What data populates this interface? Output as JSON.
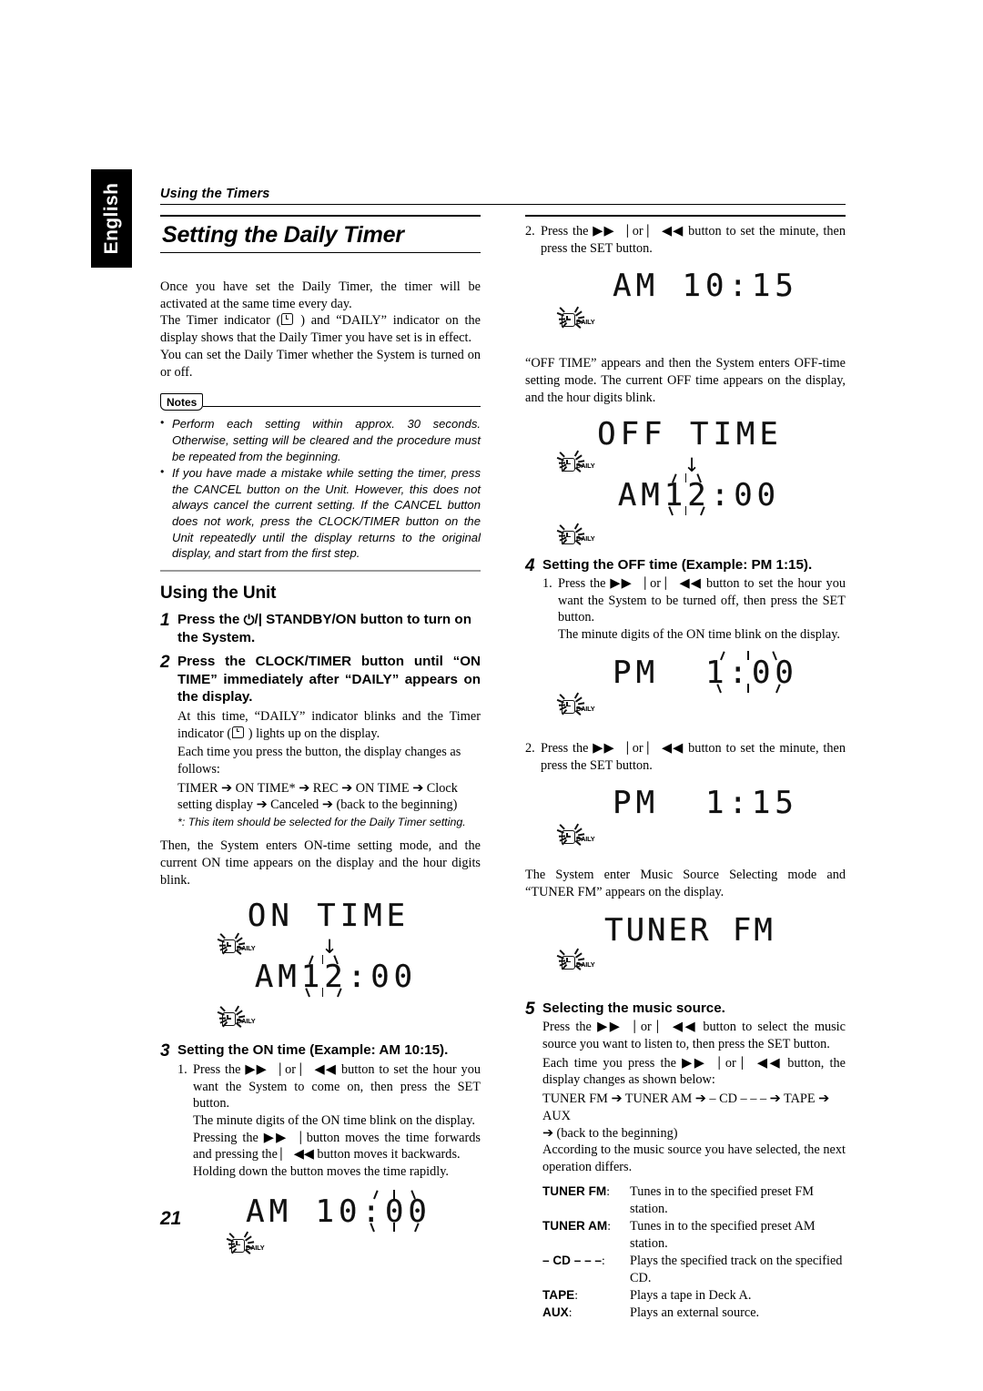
{
  "language_tab": "English",
  "running_head": "Using the Timers",
  "chapter_title": "Setting the Daily Timer",
  "page_number": "21",
  "intro": {
    "p1": "Once you have set the Daily Timer, the timer will be activated at the same time every day.",
    "p2_before": "The Timer indicator  (",
    "p2_after": " ) and “DAILY” indicator on the display shows that the Daily Timer you have set is in effect.",
    "p3": "You can set the Daily Timer whether the System is turned on or off."
  },
  "notes": {
    "label": "Notes",
    "items": [
      "Perform each setting within approx. 30 seconds. Otherwise, setting will be cleared and the procedure must be repeated from the beginning.",
      "If you have made a mistake while setting the timer, press the CANCEL button on the Unit. However, this does not always cancel the current setting. If the CANCEL button does not work, press the CLOCK/TIMER button on the Unit repeatedly until the display returns to the original display, and start from the first step."
    ]
  },
  "using_the_unit": {
    "heading": "Using the Unit",
    "step1": {
      "num": "1",
      "title_before": "Press the ",
      "power_icon": "⏻",
      "title_after": "/| STANDBY/ON button to turn on the System."
    },
    "step2": {
      "num": "2",
      "title": "Press the CLOCK/TIMER button until “ON TIME” immediately after “DAILY” appears on the display.",
      "sub1_before": "At this time, “DAILY” indicator blinks and the Timer indicator  (",
      "sub1_after": " ) lights up on the display.",
      "sub2": "Each time you press the button, the display changes as follows:",
      "sequence": "TIMER ➔ ON TIME* ➔ REC ➔ ON TIME ➔ Clock setting display ➔ Canceled ➔ (back to the beginning)",
      "footnote": "*: This item should be selected for the Daily Timer setting."
    },
    "after_step2": "Then, the System enters ON-time setting mode, and the current ON time appears on the display and the hour digits blink."
  },
  "figures": {
    "on_time": {
      "line1": "ON TIME",
      "arrow": "↓",
      "line2_static_left": "AM",
      "line2_blink": "12",
      "line2_static_right": ":00",
      "indicator": "DAILY"
    },
    "am_10_00": {
      "line_static_left": "AM 10",
      "line_blink": ":00",
      "indicator": "DAILY"
    },
    "am_10_15": {
      "line": "AM 10:15",
      "indicator": "DAILY"
    },
    "off_time": {
      "line1": "OFF TIME",
      "arrow": "↓",
      "line2_static_left": "AM",
      "line2_blink": "12",
      "line2_static_right": ":00",
      "indicator": "DAILY"
    },
    "pm_1_00": {
      "line_static_left": "PM  ",
      "line_blink": "1:00",
      "indicator": "DAILY"
    },
    "pm_1_15": {
      "line": "PM  1:15",
      "indicator": "DAILY"
    },
    "tuner_fm": {
      "line": "TUNER FM",
      "indicator": "DAILY"
    }
  },
  "step3": {
    "num": "3",
    "title": "Setting the ON time (Example: AM 10:15).",
    "item_num": "1.",
    "line1": "Press the ▶▶⎹ or ⎸◀◀ button to set the hour you want the System to come on, then press the SET button.",
    "line2": "The minute digits of the ON time blink on the display.",
    "line3": "Pressing the ▶▶⎹ button moves the time forwards and pressing the ⎸◀◀ button moves it backwards.",
    "line4": "Holding down the button moves the time rapidly."
  },
  "right_column": {
    "step3_item2": {
      "item_num": "2.",
      "text": "Press the ▶▶⎹ or ⎸◀◀ button to set the minute, then press the SET button."
    },
    "off_time_intro": "“OFF TIME” appears and then the System enters OFF-time setting mode. The current OFF time appears on the display, and the hour digits blink.",
    "step4": {
      "num": "4",
      "title": "Setting the OFF time (Example: PM 1:15).",
      "item1_num": "1.",
      "item1_line1": "Press the ▶▶⎹ or ⎸◀◀ button to set the hour you want the System to be turned off, then press the SET button.",
      "item1_line2": "The minute digits of the ON time blink on the display.",
      "item2_num": "2.",
      "item2_text": "Press the ▶▶⎹ or ⎸◀◀ button to set the minute, then press the SET button."
    },
    "tuner_intro": "The System enter Music Source Selecting mode and “TUNER FM” appears on the display.",
    "step5": {
      "num": "5",
      "title": "Selecting the music source.",
      "line1": "Press the ▶▶⎹ or ⎸◀◀ button to select the music source you want to listen to, then press the SET button.",
      "line2": "Each time you press the ▶▶⎹ or ⎸◀◀ button, the display changes as shown below:",
      "sequence1": "TUNER FM ➔ TUNER AM ➔ – CD – – – ➔ TAPE ➔ AUX",
      "sequence2": "➔ (back to the beginning)",
      "line3": "According to the music source you have selected, the next operation differs.",
      "sources": [
        {
          "term": "TUNER FM",
          "desc": "Tunes in to the specified preset FM station."
        },
        {
          "term": "TUNER AM",
          "desc": "Tunes in to the specified preset AM station."
        },
        {
          "term": "– CD – – –",
          "desc": "Plays the specified track on the specified CD."
        },
        {
          "term": "TAPE",
          "desc": "Plays a tape in Deck A."
        },
        {
          "term": "AUX",
          "desc": "Plays an external source."
        }
      ]
    }
  }
}
